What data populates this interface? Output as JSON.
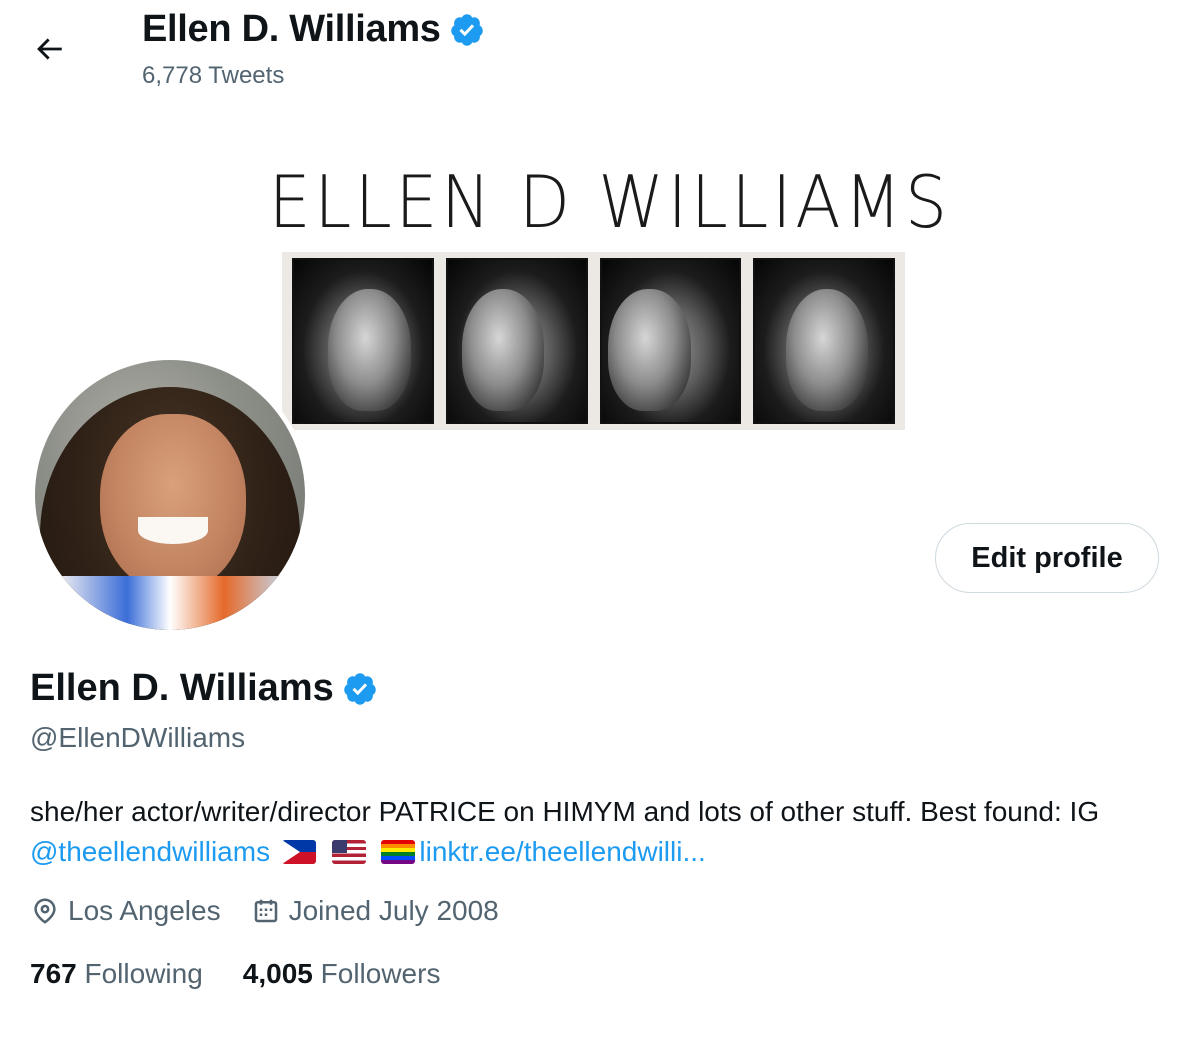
{
  "header": {
    "display_name": "Ellen D. Williams",
    "tweet_count": "6,778 Tweets"
  },
  "banner": {
    "title_text": "ELLEN D WILLIAMS"
  },
  "profile": {
    "display_name": "Ellen D. Williams",
    "handle": "@EllenDWilliams",
    "edit_button_label": "Edit profile",
    "bio": {
      "text_1": "she/her actor/writer/director PATRICE on HIMYM and lots of other stuff. Best found: IG ",
      "mention": "@theellendwilliams",
      "link": "linktr.ee/theellendwilli..."
    },
    "location": "Los Angeles",
    "joined": "Joined July 2008",
    "following_count": "767",
    "following_label": "Following",
    "followers_count": "4,005",
    "followers_label": "Followers"
  },
  "icons": {
    "back": "arrow-left-icon",
    "verified": "verified-badge-icon",
    "location": "location-pin-icon",
    "calendar": "calendar-icon"
  },
  "colors": {
    "accent": "#1d9bf0",
    "text_primary": "#0f1419",
    "text_secondary": "#536471",
    "border": "#cfd9de"
  }
}
